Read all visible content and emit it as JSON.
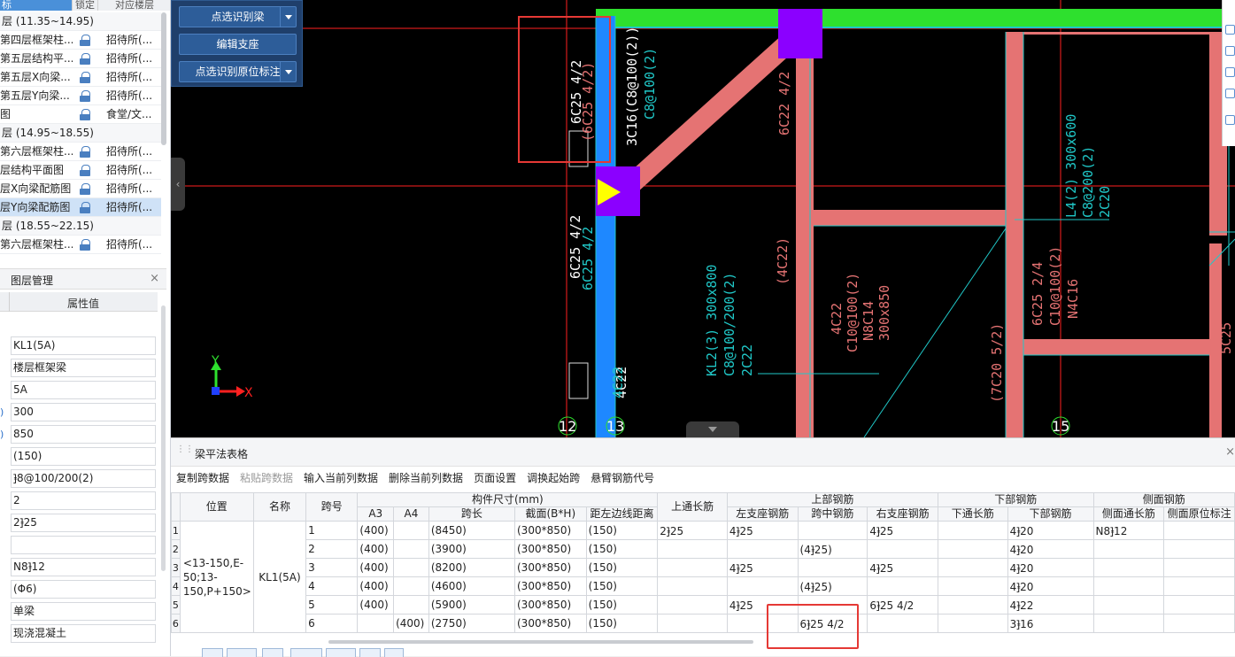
{
  "floors": {
    "headers": [
      "标",
      "锁定",
      "对应楼层"
    ],
    "rows": [
      {
        "type": "group",
        "name": "层 (11.35~14.95)"
      },
      {
        "type": "item",
        "name": "第四层框架柱...",
        "owner": "招待所(..."
      },
      {
        "type": "item",
        "name": "第五层结构平...",
        "owner": "招待所(..."
      },
      {
        "type": "item",
        "name": "第五层X向梁...",
        "owner": "招待所(..."
      },
      {
        "type": "item",
        "name": "第五层Y向梁...",
        "owner": "招待所(..."
      },
      {
        "type": "item",
        "name": "图",
        "owner": "食堂/文..."
      },
      {
        "type": "group",
        "name": "层 (14.95~18.55)"
      },
      {
        "type": "item",
        "name": "第六层框架柱...",
        "owner": "招待所(..."
      },
      {
        "type": "item",
        "name": "层结构平面图",
        "owner": "招待所(..."
      },
      {
        "type": "item",
        "name": "层X向梁配筋图",
        "owner": "招待所(..."
      },
      {
        "type": "item",
        "name": "层Y向梁配筋图",
        "owner": "招待所(...",
        "selected": true
      },
      {
        "type": "group",
        "name": "层 (18.55~22.15)"
      },
      {
        "type": "item",
        "name": "第六层框架柱...",
        "owner": "招待所(..."
      }
    ]
  },
  "layer_panel": {
    "title": "图层管理",
    "close": "×"
  },
  "props": {
    "header": "属性值",
    "values": [
      "KL1(5A)",
      "楼层框架梁",
      "5A",
      "300",
      "850",
      "(150)",
      "⹘8@100/200(2)",
      "2",
      "2⹘25",
      "",
      "N8⹘12",
      "(Φ6)",
      "单梁",
      "现浇混凝土"
    ],
    "markers": [
      "",
      "",
      "",
      ")",
      ")",
      "",
      "",
      "",
      "",
      "",
      "",
      "",
      "",
      ""
    ]
  },
  "tool_panel": {
    "buttons": [
      "点选识别梁",
      "编辑支座",
      "点选识别原位标注"
    ]
  },
  "cad": {
    "annotations": {
      "a1": "6C25 4/2",
      "a2": "(6C25 4/2)",
      "a3": "3C16(C8@100(2))",
      "a4": "C8@100(2)",
      "a5": "6C22 4/2",
      "a6": "6C25 4/2",
      "a7": "6C25 4/2",
      "a8": "4C22",
      "a9": "4C22",
      "a10": "(4C22)",
      "a11": "KL2(3) 300x800",
      "a12": "C8@100/200(2)",
      "a13": "2C22",
      "a14": "4C22",
      "a15": "C10@100(2)",
      "a16": "N8C14",
      "a17": "300x850",
      "a18": "(7C20 5/2)",
      "a19": "L4(2) 300x600",
      "a20": "C8@200(2)",
      "a21": "2C20",
      "a22": "6C25 2/4",
      "a23": "C10@100(2)",
      "a24": "N4C16",
      "a25": "5C25",
      "g12": "12",
      "g13": "13",
      "g15": "15",
      "axis_x": "X",
      "axis_y": "Y"
    }
  },
  "table_panel": {
    "title": "梁平法表格",
    "close": "×",
    "toolbar": [
      {
        "label": "复制跨数据",
        "enabled": true
      },
      {
        "label": "粘贴跨数据",
        "enabled": false
      },
      {
        "label": "输入当前列数据",
        "enabled": true
      },
      {
        "label": "删除当前列数据",
        "enabled": true
      },
      {
        "label": "页面设置",
        "enabled": true
      },
      {
        "label": "调换起始跨",
        "enabled": true
      },
      {
        "label": "悬臂钢筋代号",
        "enabled": true
      }
    ],
    "groups": {
      "pos": "位置",
      "name": "名称",
      "span": "跨号",
      "dims": "构件尺寸(mm)",
      "top_through": "上通长筋",
      "top": "上部钢筋",
      "bottom": "下部钢筋",
      "side": "侧面钢筋"
    },
    "subheaders": [
      "A3",
      "A4",
      "跨长",
      "截面(B*H)",
      "距左边线距离",
      "左支座钢筋",
      "跨中钢筋",
      "右支座钢筋",
      "下通长筋",
      "下部钢筋",
      "侧面通长筋",
      "侧面原位标注"
    ],
    "position": "<13-150,E-50;13-150,P+150>",
    "name": "KL1(5A)",
    "rows": [
      {
        "rn": "1",
        "span": "1",
        "a3": "(400)",
        "a4": "",
        "len": "(8450)",
        "sec": "(300*850)",
        "dist": "(150)",
        "top_through": "2⹘25",
        "left": "4⹘25",
        "mid": "",
        "right": "4⹘25",
        "bot_through": "",
        "bot": "4⹘20",
        "side_through": "N8⹘12",
        "side_note": ""
      },
      {
        "rn": "2",
        "span": "2",
        "a3": "(400)",
        "a4": "",
        "len": "(3900)",
        "sec": "(300*850)",
        "dist": "(150)",
        "top_through": "",
        "left": "",
        "mid": "(4⹘25)",
        "right": "",
        "bot_through": "",
        "bot": "4⹘20",
        "side_through": "",
        "side_note": ""
      },
      {
        "rn": "3",
        "span": "3",
        "a3": "(400)",
        "a4": "",
        "len": "(8200)",
        "sec": "(300*850)",
        "dist": "(150)",
        "top_through": "",
        "left": "4⹘25",
        "mid": "",
        "right": "4⹘25",
        "bot_through": "",
        "bot": "4⹘20",
        "side_through": "",
        "side_note": ""
      },
      {
        "rn": "4",
        "span": "4",
        "a3": "(400)",
        "a4": "",
        "len": "(4600)",
        "sec": "(300*850)",
        "dist": "(150)",
        "top_through": "",
        "left": "",
        "mid": "(4⹘25)",
        "right": "",
        "bot_through": "",
        "bot": "4⹘20",
        "side_through": "",
        "side_note": ""
      },
      {
        "rn": "5",
        "span": "5",
        "a3": "(400)",
        "a4": "",
        "len": "(5900)",
        "sec": "(300*850)",
        "dist": "(150)",
        "top_through": "",
        "left": "4⹘25",
        "mid": "",
        "right": "6⹘25 4/2",
        "bot_through": "",
        "bot": "4⹘22",
        "side_through": "",
        "side_note": ""
      },
      {
        "rn": "6",
        "span": "6",
        "a3": "",
        "a4": "(400)",
        "len": "(2750)",
        "sec": "(300*850)",
        "dist": "(150)",
        "top_through": "",
        "left": "",
        "mid": "6⹘25 4/2",
        "right": "",
        "bot_through": "",
        "bot": "3⹘16",
        "side_through": "",
        "side_note": ""
      }
    ]
  },
  "colors": {
    "beam_pink": "#e57373",
    "beam_green": "#2ee02e",
    "beam_blue": "#1e88ff",
    "column_purple": "#8b00ff",
    "grid_red": "#ff2020",
    "cyan": "#20c8c8",
    "highlight": "#e53935"
  }
}
